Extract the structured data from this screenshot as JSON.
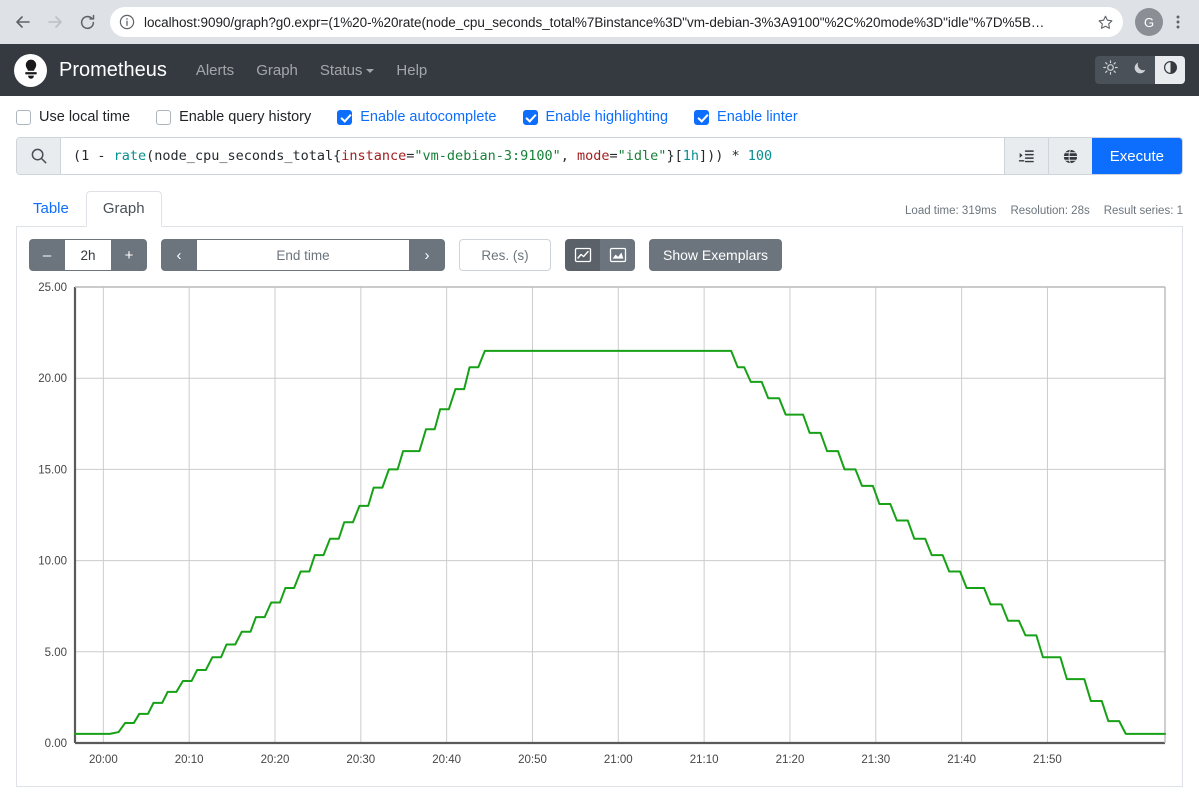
{
  "browser": {
    "back_icon": "arrow-left-icon",
    "forward_icon": "arrow-right-icon",
    "reload_icon": "reload-icon",
    "site_info_icon": "info-circle-icon",
    "url": "localhost:9090/graph?g0.expr=(1%20-%20rate(node_cpu_seconds_total%7Binstance%3D\"vm-debian-3%3A9100\"%2C%20mode%3D\"idle\"%7D%5B…",
    "bookmark_icon": "star-icon",
    "profile_initial": "G",
    "menu_icon": "kebab-menu-icon"
  },
  "navbar": {
    "logo_icon": "prometheus-logo-icon",
    "brand": "Prometheus",
    "links": [
      {
        "label": "Alerts",
        "has_caret": false
      },
      {
        "label": "Graph",
        "has_caret": false
      },
      {
        "label": "Status",
        "has_caret": true
      },
      {
        "label": "Help",
        "has_caret": false
      }
    ],
    "theme_buttons": [
      {
        "name": "theme-light-button",
        "icon": "sun-icon",
        "active": false
      },
      {
        "name": "theme-dark-button",
        "icon": "moon-icon",
        "active": false
      },
      {
        "name": "theme-auto-button",
        "icon": "half-circle-icon",
        "active": true
      }
    ]
  },
  "options": [
    {
      "label": "Use local time",
      "checked": false
    },
    {
      "label": "Enable query history",
      "checked": false
    },
    {
      "label": "Enable autocomplete",
      "checked": true
    },
    {
      "label": "Enable highlighting",
      "checked": true
    },
    {
      "label": "Enable linter",
      "checked": true
    }
  ],
  "query": {
    "search_icon": "search-icon",
    "expression": "(1 - rate(node_cpu_seconds_total{instance=\"vm-debian-3:9100\", mode=\"idle\"}[1h])) * 100",
    "tokens": [
      {
        "text": "(1 ",
        "kind": "plain"
      },
      {
        "text": "- ",
        "kind": "plain"
      },
      {
        "text": "rate",
        "kind": "fn"
      },
      {
        "text": "(node_cpu_seconds_total{",
        "kind": "plain"
      },
      {
        "text": "instance",
        "kind": "label"
      },
      {
        "text": "=",
        "kind": "plain"
      },
      {
        "text": "\"vm-debian-3:9100\"",
        "kind": "str"
      },
      {
        "text": ", ",
        "kind": "plain"
      },
      {
        "text": "mode",
        "kind": "label"
      },
      {
        "text": "=",
        "kind": "plain"
      },
      {
        "text": "\"idle\"",
        "kind": "str"
      },
      {
        "text": "}[",
        "kind": "plain"
      },
      {
        "text": "1h",
        "kind": "dur"
      },
      {
        "text": "])) * ",
        "kind": "plain"
      },
      {
        "text": "100",
        "kind": "num"
      }
    ],
    "metric_explorer_icon": "metrics-explorer-icon",
    "globe_icon": "globe-icon",
    "execute_label": "Execute"
  },
  "tabs": {
    "items": [
      {
        "label": "Table",
        "active": false
      },
      {
        "label": "Graph",
        "active": true
      }
    ],
    "meta": {
      "load_time": "Load time: 319ms",
      "resolution": "Resolution: 28s",
      "result_series": "Result series: 1"
    }
  },
  "controls": {
    "decrease_range_label": "–",
    "range_value": "2h",
    "increase_range_label": "+",
    "prev_label": "‹",
    "end_time_placeholder": "End time",
    "next_label": "›",
    "resolution_placeholder": "Res. (s)",
    "chart_type_line_icon": "line-chart-icon",
    "chart_type_stacked_icon": "stacked-chart-icon",
    "show_exemplars_label": "Show Exemplars"
  },
  "chart_data": {
    "type": "line",
    "title": "",
    "xlabel": "",
    "ylabel": "",
    "xlim": [
      "19:57",
      "21:57"
    ],
    "ylim": [
      0,
      25
    ],
    "grid": true,
    "legend": "none",
    "series_color": "#17a117",
    "y_ticks": [
      "0.00",
      "5.00",
      "10.00",
      "15.00",
      "20.00",
      "25.00"
    ],
    "y_tick_values": [
      0,
      5,
      10,
      15,
      20,
      25
    ],
    "x_ticks": [
      "20:00",
      "20:10",
      "20:20",
      "20:30",
      "20:40",
      "20:50",
      "21:00",
      "21:10",
      "21:20",
      "21:30",
      "21:40",
      "21:50"
    ],
    "series": [
      {
        "name": "(1 - rate(node_cpu_seconds_total{instance=\"vm-debian-3:9100\", mode=\"idle\"}[1h])) * 100",
        "points": [
          [
            0.0,
            0.5
          ],
          [
            2.0,
            0.5
          ],
          [
            3.2,
            0.5
          ],
          [
            4.0,
            0.6
          ],
          [
            4.6,
            1.1
          ],
          [
            5.4,
            1.1
          ],
          [
            5.9,
            1.6
          ],
          [
            6.7,
            1.6
          ],
          [
            7.2,
            2.2
          ],
          [
            8.0,
            2.2
          ],
          [
            8.5,
            2.8
          ],
          [
            9.3,
            2.8
          ],
          [
            9.9,
            3.4
          ],
          [
            10.7,
            3.4
          ],
          [
            11.2,
            4.0
          ],
          [
            12.0,
            4.0
          ],
          [
            12.6,
            4.7
          ],
          [
            13.4,
            4.7
          ],
          [
            13.9,
            5.4
          ],
          [
            14.7,
            5.4
          ],
          [
            15.3,
            6.1
          ],
          [
            16.1,
            6.1
          ],
          [
            16.6,
            6.9
          ],
          [
            17.4,
            6.9
          ],
          [
            18.0,
            7.7
          ],
          [
            18.8,
            7.7
          ],
          [
            19.3,
            8.5
          ],
          [
            20.1,
            8.5
          ],
          [
            20.7,
            9.4
          ],
          [
            21.5,
            9.4
          ],
          [
            22.0,
            10.3
          ],
          [
            22.8,
            10.3
          ],
          [
            23.4,
            11.2
          ],
          [
            24.2,
            11.2
          ],
          [
            24.7,
            12.1
          ],
          [
            25.5,
            12.1
          ],
          [
            26.1,
            13.0
          ],
          [
            26.9,
            13.0
          ],
          [
            27.4,
            14.0
          ],
          [
            28.2,
            14.0
          ],
          [
            28.8,
            15.0
          ],
          [
            29.6,
            15.0
          ],
          [
            30.1,
            16.0
          ],
          [
            31.6,
            16.0
          ],
          [
            32.2,
            17.2
          ],
          [
            33.0,
            17.2
          ],
          [
            33.5,
            18.3
          ],
          [
            34.3,
            18.3
          ],
          [
            34.9,
            19.4
          ],
          [
            35.7,
            19.4
          ],
          [
            36.2,
            20.6
          ],
          [
            37.0,
            20.6
          ],
          [
            37.6,
            21.5
          ],
          [
            38.4,
            21.5
          ],
          [
            57.0,
            21.5
          ],
          [
            58.5,
            21.5
          ],
          [
            59.5,
            21.5
          ],
          [
            60.2,
            21.5
          ],
          [
            60.8,
            20.6
          ],
          [
            61.4,
            20.6
          ],
          [
            62.0,
            19.8
          ],
          [
            63.0,
            19.8
          ],
          [
            63.6,
            18.9
          ],
          [
            64.6,
            18.9
          ],
          [
            65.2,
            18.0
          ],
          [
            66.8,
            18.0
          ],
          [
            67.4,
            17.0
          ],
          [
            68.4,
            17.0
          ],
          [
            69.0,
            16.0
          ],
          [
            70.0,
            16.0
          ],
          [
            70.6,
            15.0
          ],
          [
            71.6,
            15.0
          ],
          [
            72.2,
            14.1
          ],
          [
            73.2,
            14.1
          ],
          [
            73.8,
            13.1
          ],
          [
            74.8,
            13.1
          ],
          [
            75.4,
            12.2
          ],
          [
            76.4,
            12.2
          ],
          [
            77.0,
            11.2
          ],
          [
            78.0,
            11.2
          ],
          [
            78.6,
            10.3
          ],
          [
            79.6,
            10.3
          ],
          [
            80.2,
            9.4
          ],
          [
            81.2,
            9.4
          ],
          [
            81.8,
            8.5
          ],
          [
            83.4,
            8.5
          ],
          [
            84.0,
            7.6
          ],
          [
            85.0,
            7.6
          ],
          [
            85.6,
            6.7
          ],
          [
            86.6,
            6.7
          ],
          [
            87.2,
            5.9
          ],
          [
            88.2,
            5.9
          ],
          [
            88.8,
            4.7
          ],
          [
            90.4,
            4.7
          ],
          [
            91.0,
            3.5
          ],
          [
            92.6,
            3.5
          ],
          [
            93.2,
            2.3
          ],
          [
            94.2,
            2.3
          ],
          [
            94.8,
            1.2
          ],
          [
            95.8,
            1.2
          ],
          [
            96.4,
            0.5
          ],
          [
            100.0,
            0.5
          ]
        ]
      }
    ]
  }
}
